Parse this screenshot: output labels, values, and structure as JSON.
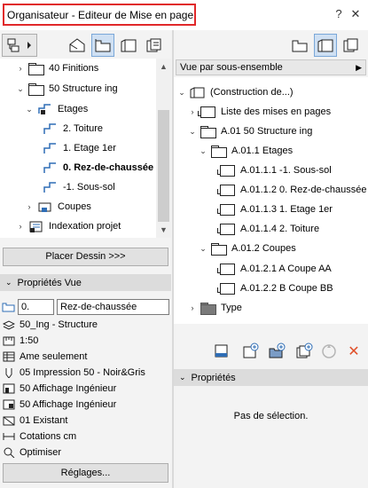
{
  "window": {
    "title": "Organisateur - Editeur de Mise en page",
    "help_label": "?",
    "close_label": "✕"
  },
  "left_tree": {
    "items": [
      {
        "label": "40 Finitions",
        "chev": "›",
        "icon": "folder",
        "bold": false
      },
      {
        "label": "50 Structure ing",
        "chev": "⌄",
        "icon": "folder",
        "bold": false
      },
      {
        "label": "Etages",
        "chev": "⌄",
        "icon": "stair",
        "bold": false
      },
      {
        "label": "2. Toiture",
        "chev": "",
        "icon": "stair",
        "bold": false
      },
      {
        "label": "1. Etage 1er",
        "chev": "",
        "icon": "stair",
        "bold": false
      },
      {
        "label": "0. Rez-de-chaussée",
        "chev": "",
        "icon": "stair",
        "bold": true
      },
      {
        "label": "-1. Sous-sol",
        "chev": "",
        "icon": "stair",
        "bold": false
      },
      {
        "label": "Coupes",
        "chev": "›",
        "icon": "section",
        "bold": false
      },
      {
        "label": "Indexation projet",
        "chev": "›",
        "icon": "index",
        "bold": false
      }
    ]
  },
  "place_button": "Placer Dessin >>>",
  "view_props": {
    "header": "Propriétés Vue",
    "id_value": "0.",
    "name_value": "Rez-de-chaussée",
    "rows": [
      "50_Ing - Structure",
      "1:50",
      "Ame seulement",
      "05 Impression 50 - Noir&Gris",
      "50 Affichage Ingénieur",
      "50 Affichage Ingénieur",
      "01 Existant",
      "Cotations cm",
      "Optimiser"
    ],
    "settings_button": "Réglages..."
  },
  "right": {
    "dropdown": "Vue par sous-ensemble",
    "tree": [
      {
        "label": "(Construction de...)",
        "chev": "⌄",
        "icon": "sheet"
      },
      {
        "label": "Liste des mises en pages",
        "chev": "›",
        "icon": "sheet"
      },
      {
        "label": "A.01 50 Structure ing",
        "chev": "⌄",
        "icon": "folder"
      },
      {
        "label": "A.01.1 Etages",
        "chev": "⌄",
        "icon": "folder"
      },
      {
        "label": "A.01.1.1 -1. Sous-sol",
        "chev": "",
        "icon": "sheet"
      },
      {
        "label": "A.01.1.2 0. Rez-de-chaussée",
        "chev": "",
        "icon": "sheet"
      },
      {
        "label": "A.01.1.3 1. Etage 1er",
        "chev": "",
        "icon": "sheet"
      },
      {
        "label": "A.01.1.4 2. Toiture",
        "chev": "",
        "icon": "sheet"
      },
      {
        "label": "A.01.2 Coupes",
        "chev": "⌄",
        "icon": "folder"
      },
      {
        "label": "A.01.2.1 A Coupe AA",
        "chev": "",
        "icon": "sheet"
      },
      {
        "label": "A.01.2.2 B Coupe BB",
        "chev": "",
        "icon": "sheet"
      },
      {
        "label": "Type",
        "chev": "›",
        "icon": "folder-dark"
      }
    ],
    "props_header": "Propriétés",
    "no_selection": "Pas de sélection.",
    "delete_label": "✕"
  },
  "colors": {
    "accent_blue": "#2e6db5",
    "title_highlight": "#e0282a",
    "delete_red": "#e0502a"
  }
}
